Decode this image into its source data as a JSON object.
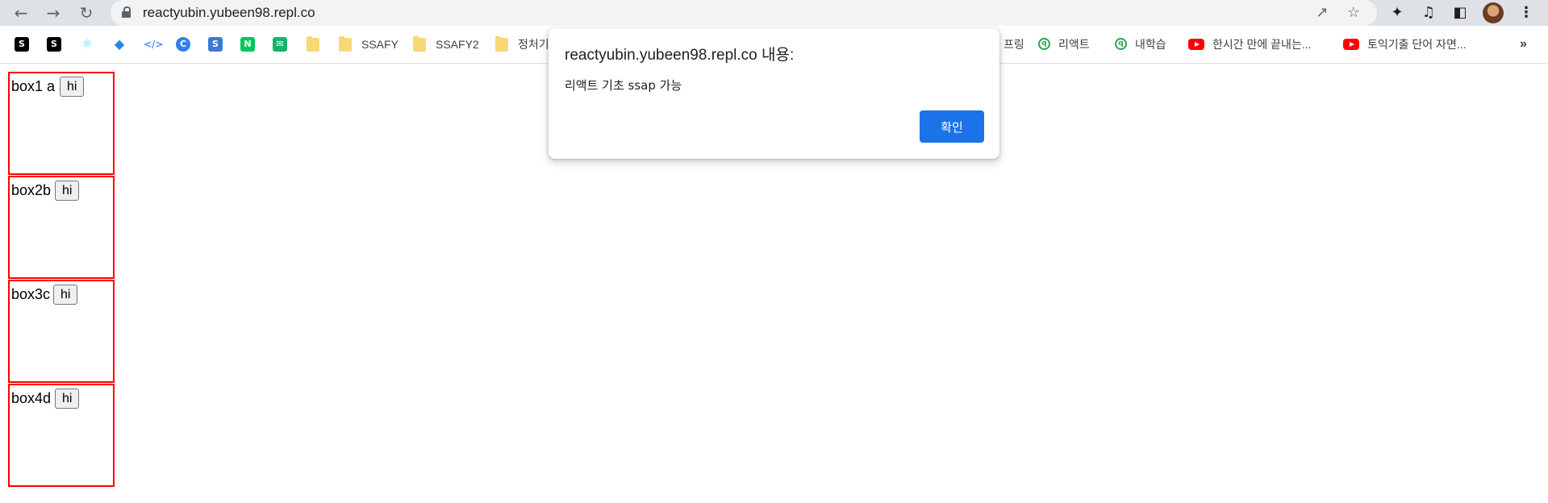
{
  "browser": {
    "url": "reactyubin.yubeen98.repl.co",
    "icons": {
      "back": "arrow-left",
      "forward": "arrow-right",
      "reload": "reload",
      "share": "share",
      "star": "star",
      "extensions": "puzzle",
      "media": "media-control",
      "sidepanel": "side-panel",
      "menu": "kebab"
    }
  },
  "bookmarks": {
    "items": [
      {
        "label": "SSAFY"
      },
      {
        "label": "SSAFY2"
      },
      {
        "label": "정처기"
      },
      {
        "label": "프링"
      },
      {
        "label": "리액트"
      },
      {
        "label": "내학습"
      },
      {
        "label": "한시간 만에 끝내는..."
      },
      {
        "label": "토익기출 단어 자면..."
      }
    ],
    "overflow": "»"
  },
  "page": {
    "boxes": [
      {
        "label": "box1 a",
        "button": "hi"
      },
      {
        "label": "box2b",
        "button": "hi"
      },
      {
        "label": "box3c",
        "button": "hi"
      },
      {
        "label": "box4d",
        "button": "hi"
      }
    ]
  },
  "dialog": {
    "title": "reactyubin.yubeen98.repl.co 내용:",
    "message": "리액트 기초 ssap 가능",
    "ok_label": "확인",
    "accent": "#1a73e8"
  }
}
